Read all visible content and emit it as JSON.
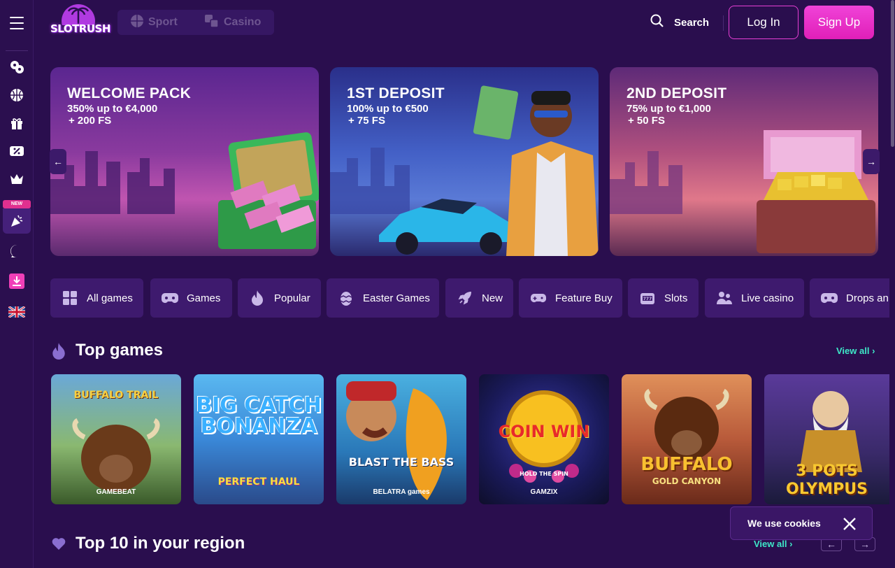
{
  "header": {
    "logo_text": "SLOTRUSH",
    "modes": [
      {
        "label": "Sport",
        "icon": "basketball-icon"
      },
      {
        "label": "Casino",
        "icon": "dice-icon"
      }
    ],
    "search_label": "Search",
    "login_label": "Log In",
    "signup_label": "Sign Up"
  },
  "sidebar": {
    "new_badge": "NEW",
    "items": [
      {
        "icon": "casino-chips-icon"
      },
      {
        "icon": "basketball-icon"
      },
      {
        "icon": "gift-icon"
      },
      {
        "icon": "percent-ticket-icon"
      },
      {
        "icon": "crown-icon"
      },
      {
        "icon": "party-popper-icon"
      },
      {
        "icon": "chat-icon"
      },
      {
        "icon": "download-icon"
      },
      {
        "icon": "uk-flag-icon"
      }
    ]
  },
  "banners": [
    {
      "title": "WELCOME PACK",
      "line1": "350% up to €4,000",
      "line2": "+ 200 FS"
    },
    {
      "title": "1ST DEPOSIT",
      "line1": "100% up to €500",
      "line2": "+ 75 FS"
    },
    {
      "title": "2ND DEPOSIT",
      "line1": "75% up to €1,000",
      "line2": "+ 50 FS"
    }
  ],
  "categories": [
    {
      "label": "All games",
      "icon": "grid-icon"
    },
    {
      "label": "Games",
      "icon": "gamepad-icon"
    },
    {
      "label": "Popular",
      "icon": "fire-icon"
    },
    {
      "label": "Easter Games",
      "icon": "easter-egg-icon"
    },
    {
      "label": "New",
      "icon": "rocket-icon"
    },
    {
      "label": "Feature Buy",
      "icon": "joystick-icon"
    },
    {
      "label": "Slots",
      "icon": "slot-777-icon"
    },
    {
      "label": "Live casino",
      "icon": "people-icon"
    },
    {
      "label": "Drops an",
      "icon": "gamepad-icon"
    }
  ],
  "top_games": {
    "title": "Top games",
    "view_all": "View all",
    "games": [
      {
        "name": "BUFFALO TRAIL",
        "provider": "GAMEBEAT"
      },
      {
        "name": "BIG CATCH BONANZA",
        "subtitle": "PERFECT HAUL",
        "provider": ""
      },
      {
        "name": "BLAST THE BASS",
        "provider": "BELATRA games"
      },
      {
        "name": "COIN WIN",
        "subtitle": "HOLD THE SPIN",
        "provider": "GAMZIX"
      },
      {
        "name": "BUFFALO",
        "subtitle": "GOLD CANYON",
        "provider": ""
      },
      {
        "name": "3 POTS OLYMPUS",
        "provider": ""
      }
    ]
  },
  "top10": {
    "title": "Top 10 in your region",
    "view_all": "View all"
  },
  "cookie": {
    "text": "We use cookies"
  },
  "colors": {
    "bg": "#2a0e4e",
    "accent_pink": "#e63fd4",
    "accent_teal": "#3ee8c8",
    "tab_bg": "#3e1a6e"
  }
}
